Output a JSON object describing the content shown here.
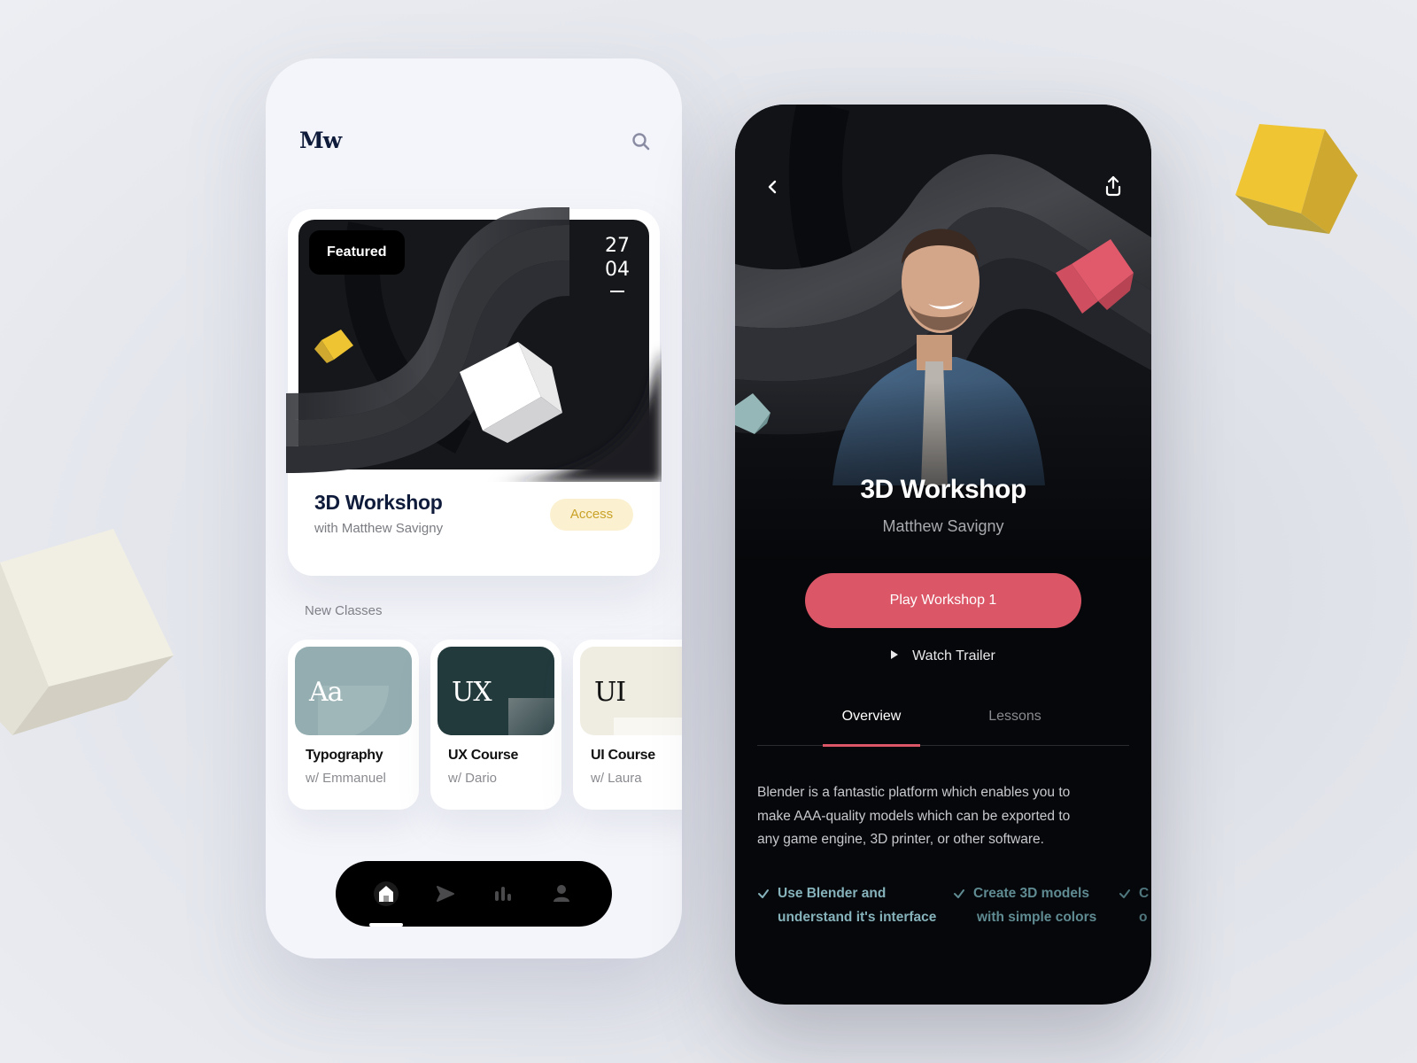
{
  "colors": {
    "accent_red": "#db5667",
    "accent_yellow": "#f0c53a",
    "navy": "#0f1b3a",
    "teal_text": "#86b3bb",
    "access_bg": "#fbf1d0",
    "access_text": "#c9a227"
  },
  "home": {
    "logo": "Mw",
    "search_icon": "search-icon",
    "featured": {
      "badge": "Featured",
      "date_day": "27",
      "date_month": "04",
      "title": "3D Workshop",
      "subtitle": "with Matthew Savigny",
      "access_label": "Access"
    },
    "new_classes_label": "New Classes",
    "classes": [
      {
        "thumb": "Aa",
        "title": "Typography",
        "instructor": "w/ Emmanuel",
        "color": "#93adb1"
      },
      {
        "thumb": "UX",
        "title": "UX Course",
        "instructor": "w/ Dario",
        "color": "#233a3d"
      },
      {
        "thumb": "UI",
        "title": "UI Course",
        "instructor": "w/ Laura",
        "color": "#efede2"
      }
    ],
    "nav": [
      {
        "icon": "home-icon",
        "active": true
      },
      {
        "icon": "play-icon",
        "active": false
      },
      {
        "icon": "stats-icon",
        "active": false
      },
      {
        "icon": "profile-icon",
        "active": false
      }
    ]
  },
  "detail": {
    "back_icon": "chevron-left-icon",
    "share_icon": "share-icon",
    "title": "3D Workshop",
    "instructor": "Matthew Savigny",
    "play_label": "Play Workshop 1",
    "trailer_label": "Watch Trailer",
    "tabs": [
      {
        "label": "Overview",
        "active": true
      },
      {
        "label": "Lessons",
        "active": false
      }
    ],
    "description": "Blender is a fantastic platform which enables you to make AAA-quality models which can be exported to any game engine, 3D printer, or other software.",
    "features": [
      {
        "line1": "Use Blender and",
        "line2": "understand it's interface"
      },
      {
        "line1": "Create 3D models",
        "line2": "with simple colors"
      },
      {
        "line1": "C",
        "line2": "o"
      }
    ]
  }
}
